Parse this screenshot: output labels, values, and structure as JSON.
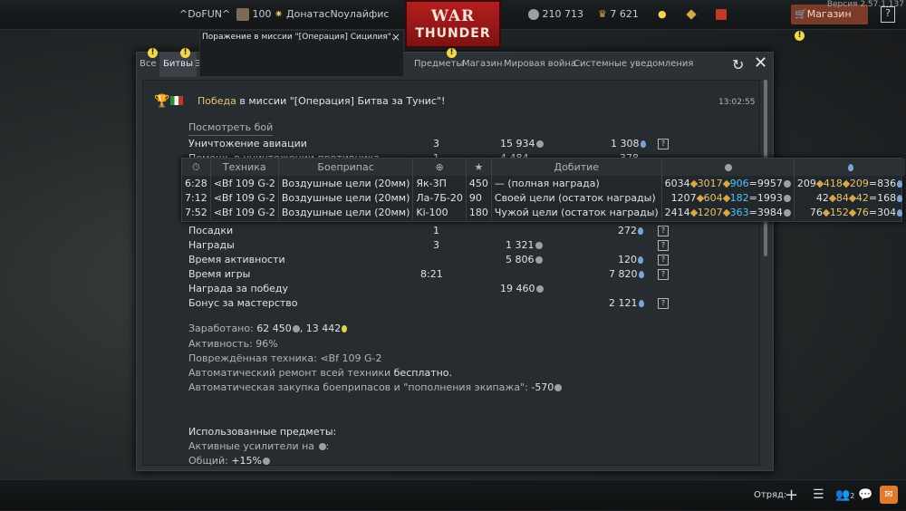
{
  "topbar": {
    "version": "Версия 2.57.1.137",
    "squad_tag": "^DoFUN^",
    "level": "100",
    "player_name": "ДонатасNoулайфис",
    "silver_lions": "210 713",
    "golden_eagles": "7 621",
    "logo_line1": "WAR",
    "logo_line2": "THUNDER",
    "shop_label": "Магазин",
    "help_label": "?"
  },
  "notification": {
    "text_bold": "Поражение",
    "text_rest": " в миссии \"[Операция] Сицилия\".",
    "close": "×"
  },
  "tabs": [
    {
      "label": "Все"
    },
    {
      "label": "Битвы"
    },
    {
      "label": "Э"
    },
    {
      "label": "Предметы"
    },
    {
      "label": "Магазин"
    },
    {
      "label": "Мировая война"
    },
    {
      "label": "Системные уведомления"
    }
  ],
  "message": {
    "title_result": "Победа",
    "title_rest": " в миссии \"[Операция] Битва за Тунис\"!",
    "time": "13:02:55",
    "view_battle": "Посмотреть бой"
  },
  "rows_top": [
    {
      "label": "Уничтожение авиации",
      "count": "3",
      "sl": "15 934",
      "rp": "1 308"
    },
    {
      "label": "Помощь в уничтожении противника",
      "count": "1",
      "sl": "4 484",
      "rp": "378"
    }
  ],
  "overlay": {
    "headers": [
      "Техника",
      "Боеприпас",
      "Добитие"
    ],
    "rows": [
      {
        "time": "6:28",
        "vehicle": "Bf 109 G-2",
        "ammo": "Воздушные цели (20мм)",
        "target": "Як-3П",
        "score": "450",
        "finish": "— (полная награда)",
        "sl_a": "6034",
        "sl_b": "3017",
        "sl_c": "906",
        "sl_d": "9957",
        "rp_a": "209",
        "rp_b": "418",
        "rp_c": "209",
        "rp_d": "836"
      },
      {
        "time": "7:12",
        "vehicle": "Bf 109 G-2",
        "ammo": "Воздушные цели (20мм)",
        "target": "Ла-7Б-20",
        "score": "90",
        "finish": "Своей цели (остаток награды)",
        "sl_a": "1207",
        "sl_b": "604",
        "sl_c": "182",
        "sl_d": "1993",
        "rp_a": "42",
        "rp_b": "84",
        "rp_c": "42",
        "rp_d": "168"
      },
      {
        "time": "7:52",
        "vehicle": "Bf 109 G-2",
        "ammo": "Воздушные цели (20мм)",
        "target": "Ki-100",
        "score": "180",
        "finish": "Чужой цели (остаток награды)",
        "sl_a": "2414",
        "sl_b": "1207",
        "sl_c": "363",
        "sl_d": "3984",
        "rp_a": "76",
        "rp_b": "152",
        "rp_c": "76",
        "rp_d": "304"
      }
    ]
  },
  "rows_bottom": [
    {
      "label": "Посадки",
      "count": "1",
      "sl": "",
      "rp": "272"
    },
    {
      "label": "Награды",
      "count": "3",
      "sl": "1 321",
      "rp": ""
    },
    {
      "label": "Время активности",
      "count": "",
      "sl": "5 806",
      "rp": "120"
    },
    {
      "label": "Время игры",
      "count": "8:21",
      "sl": "",
      "rp": "7 820"
    },
    {
      "label": "Награда за победу",
      "count": "",
      "sl": "19 460",
      "rp": ""
    },
    {
      "label": "Бонус за мастерство",
      "count": "",
      "sl": "",
      "rp": "2 121"
    }
  ],
  "summary": {
    "earned_label": "Заработано: ",
    "earned_sl": "62 450",
    "earned_rp": ", 13 442",
    "activity": "Активность: 96%",
    "damaged_label": "Повреждённая техника: ",
    "damaged_vehicle": "Bf 109 G-2",
    "repair_label": "Автоматический ремонт всей техники ",
    "repair_value": "бесплатно.",
    "ammo_label": "Автоматическая закупка боеприпасов и \"пополнения экипажа\": ",
    "ammo_value": "-570",
    "items_label": "Использованные предметы:",
    "boosters_label": "Активные усилители на ",
    "boosters_colon": ":",
    "total_label": "Общий: ",
    "total_value": "+15%"
  },
  "bottombar": {
    "squad_label": "Отряд:",
    "contacts_count": "2"
  }
}
